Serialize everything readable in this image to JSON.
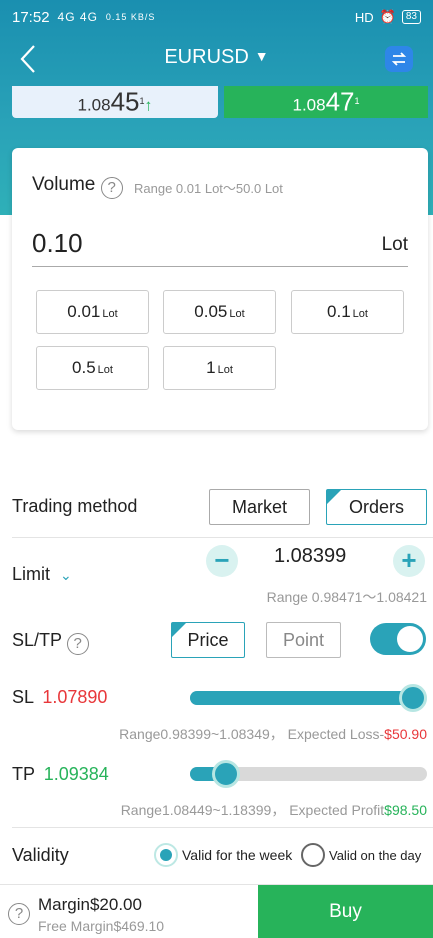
{
  "status_bar": {
    "time": "17:52",
    "signals": "4G 4G",
    "speed": "0.15 KB/S",
    "right_icons": "HD",
    "battery": "83"
  },
  "header": {
    "title": "EURUSD",
    "sell_price_prefix": "1.08",
    "sell_price_big": "45",
    "sell_price_suffix": "1",
    "buy_price_prefix": "1.08",
    "buy_price_big": "47",
    "buy_price_suffix": "1"
  },
  "volume": {
    "label": "Volume",
    "help": "?",
    "range": "Range  0.01 Lot～50.0 Lot",
    "value": "0.10",
    "unit": "Lot",
    "presets": [
      {
        "value": "0.01",
        "unit": "Lot"
      },
      {
        "value": "0.05",
        "unit": "Lot"
      },
      {
        "value": "0.1",
        "unit": "Lot"
      },
      {
        "value": "0.5",
        "unit": "Lot"
      },
      {
        "value": "1",
        "unit": "Lot"
      }
    ]
  },
  "trading_method": {
    "label": "Trading method",
    "options": [
      "Market",
      "Orders"
    ],
    "selected": "Orders"
  },
  "limit": {
    "label": "Limit",
    "minus": "−",
    "plus": "+",
    "value": "1.08399",
    "range": "Range 0.98471～1.08421"
  },
  "sltp": {
    "label": "SL/TP",
    "help": "?",
    "modes": [
      "Price",
      "Point"
    ],
    "selected": "Price",
    "enabled": true
  },
  "sl": {
    "label": "SL",
    "value": "1.07890",
    "level": 0.94,
    "range_text": "Range0.98399~1.08349， Expected Loss-",
    "amount": "$50.90"
  },
  "tp": {
    "label": "TP",
    "value": "1.09384",
    "level": 0.15,
    "range_text": "Range1.08449~1.18399， Expected Profit",
    "amount": "$98.50"
  },
  "validity": {
    "label": "Validity",
    "options": [
      "Valid for the week",
      "Valid on the day"
    ],
    "selected": "Valid for the week"
  },
  "footer": {
    "help": "?",
    "margin": "Margin$20.00",
    "free_margin": "Free Margin$469.10",
    "buy_label": "Buy"
  },
  "colors": {
    "accent": "#2aa3b8",
    "buy_green": "#27b35a",
    "loss_red": "#e8373a"
  }
}
